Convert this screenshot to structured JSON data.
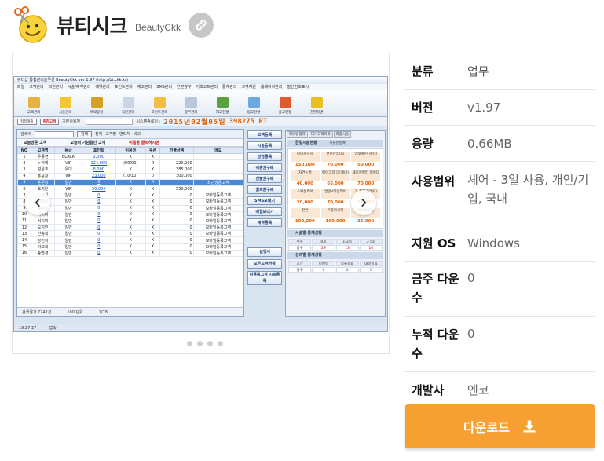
{
  "header": {
    "title": "뷰티시크",
    "subtitle": "BeautyCkk",
    "link_icon": "link-icon",
    "app_icon": "smiley-scissors-icon"
  },
  "gallery": {
    "prev_icon": "chevron-left-icon",
    "next_icon": "chevron-right-icon",
    "dot_count": 4,
    "screenshot": {
      "window_title": "뷰티샵 통합관리솔루션 BeautyCkk ver 1.97 (http://bt.ckk.kr)",
      "menu": [
        "파일",
        "고객관리",
        "직원관리",
        "시술/예약관리",
        "예약관리",
        "포인트관리",
        "재고관리",
        "SMS관리",
        "간편장부",
        "기초코드관리",
        "통계관리",
        "고객지원",
        "홈페이지관리",
        "발신번호표시"
      ],
      "toolbar": [
        "고객관리",
        "시술관리",
        "예약일정",
        "직원관리",
        "포인트관리",
        "장부관리",
        "재고현황",
        "입고현황",
        "출고현황",
        "간편화면"
      ],
      "status_tags": [
        "접점매출",
        "마감고객"
      ],
      "status_label": "기본사용자 :",
      "status_date_label": "시스템종료일 :",
      "status_date": "2015년02월05일",
      "status_points": "398275 PT",
      "search_label": "검색어",
      "search_button": "검색",
      "search_options": [
        "전체",
        "고객명",
        "연락처",
        "비고"
      ],
      "sub_titles": [
        "오늘방문 고객",
        "오늘의 기념일인 고객",
        "이름을 클릭하시면"
      ],
      "table_headers": [
        "NO",
        "고객명",
        "등급",
        "포인트",
        "이용권",
        "쿠폰",
        "선불금액",
        "메모"
      ],
      "table_rows": [
        [
          "1",
          "우종현",
          "BLACK",
          "2,000",
          "X",
          "X",
          "",
          ""
        ],
        [
          "2",
          "누적예",
          "VIP",
          "124,000",
          "(90/90)",
          "0",
          "220,000",
          ""
        ],
        [
          "3",
          "엄은효",
          "우대",
          "8,000",
          "X",
          "X",
          "385,000",
          ""
        ],
        [
          "4",
          "홍문창",
          "VIP",
          "23,000",
          "(10/10)",
          "0",
          "300,000",
          ""
        ],
        [
          "5",
          "윤준장",
          "일반",
          "0",
          "X",
          "X",
          "",
          "최근방문고객"
        ],
        [
          "6",
          "호지은",
          "VIP",
          "50,000",
          "X",
          "X",
          "550,000",
          ""
        ],
        [
          "7",
          "오정길",
          "일반",
          "0",
          "X",
          "X",
          "0",
          "모바일등록고객"
        ],
        [
          "8",
          "장자우",
          "일반",
          "0",
          "X",
          "X",
          "0",
          "모바일등록고객"
        ],
        [
          "9",
          "효여운",
          "일반",
          "0",
          "X",
          "X",
          "0",
          "모바일등록고객"
        ],
        [
          "10",
          "가지미",
          "일반",
          "0",
          "X",
          "X",
          "0",
          "모바일등록고객"
        ],
        [
          "11",
          "서지미",
          "일반",
          "0",
          "X",
          "X",
          "0",
          "모바일등록고객"
        ],
        [
          "12",
          "오지민",
          "일반",
          "0",
          "X",
          "X",
          "0",
          "모바일등록고객"
        ],
        [
          "13",
          "안송희",
          "일반",
          "0",
          "X",
          "X",
          "0",
          "모바일등록고객"
        ],
        [
          "14",
          "강진지",
          "일반",
          "0",
          "X",
          "X",
          "0",
          "모바일등록고객"
        ],
        [
          "15",
          "아꼬희",
          "일반",
          "0",
          "X",
          "X",
          "0",
          "모바일등록고객"
        ],
        [
          "16",
          "종연경",
          "일반",
          "0",
          "X",
          "X",
          "0",
          "모바일등록고객"
        ]
      ],
      "footer_left": "검색결과 7742건",
      "footer_page": "100 단위",
      "footer_pager": "1/78",
      "mid_buttons": [
        "고객등록",
        "시술등록",
        "상담등록",
        "이용권구매",
        "선불권구매",
        "월회원구매",
        "SMS보내기",
        "메일보내기",
        "예약등록"
      ],
      "mid_bottom_buttons": [
        "설명서",
        "오픈고객현황",
        "미등록고객 시술등록"
      ],
      "right_tabs": [
        "예약일정표",
        "대기고객목록",
        "최종시술"
      ],
      "right_head": "금일시술현황",
      "right_checkbox": "시술만등록",
      "right_grid": [
        [
          "타이파시지",
          "150,000"
        ],
        [
          "천천관리(A)",
          "70,000"
        ],
        [
          "엠보볼린(해일)",
          "50,000"
        ],
        [
          "자연눈썹",
          "40,000"
        ],
        [
          "메이크업 리(헤나)",
          "65,000"
        ],
        [
          "세이지컬러 팩이다",
          "70,000"
        ],
        [
          "스페셜케어",
          "20,000"
        ],
        [
          "얼굴V라인케어",
          "70,000"
        ],
        [
          "가 천전관리(B)",
          "80,000"
        ],
        [
          "전반",
          "100,000"
        ],
        [
          "커플마사지",
          "100,000"
        ],
        [
          "속눈썹연장",
          "35,000"
        ]
      ],
      "right_stat1_title": "시술별 통계상황",
      "right_stat1_headers": [
        "횟수",
        "0회",
        "1-2회",
        "3-5회"
      ],
      "right_stat1_values": [
        "명수",
        "29",
        "13",
        "16"
      ],
      "right_stat2_title": "성과별 통계상황",
      "right_stat2_headers": [
        "기간",
        "이벤트",
        "오늘종료",
        "내일종료"
      ],
      "right_stat2_values": [
        "명수",
        "0",
        "0",
        "0"
      ],
      "bottom_time": "19:27:27",
      "bottom_status": "접속"
    }
  },
  "info": {
    "rows": [
      {
        "key": "분류",
        "value": "업무"
      },
      {
        "key": "버전",
        "value": "v1.97"
      },
      {
        "key": "용량",
        "value": "0.66MB"
      },
      {
        "key": "사용범위",
        "value": "셰어 - 3일 사용, 개인/기업, 국내"
      },
      {
        "key": "지원 OS",
        "value": "Windows"
      },
      {
        "key": "금주 다운수",
        "value": "0"
      },
      {
        "key": "누적 다운수",
        "value": "0"
      },
      {
        "key": "개발사",
        "value": "엔코"
      }
    ]
  },
  "download": {
    "label": "다운로드",
    "icon": "download-icon",
    "color": "#f6a033"
  }
}
